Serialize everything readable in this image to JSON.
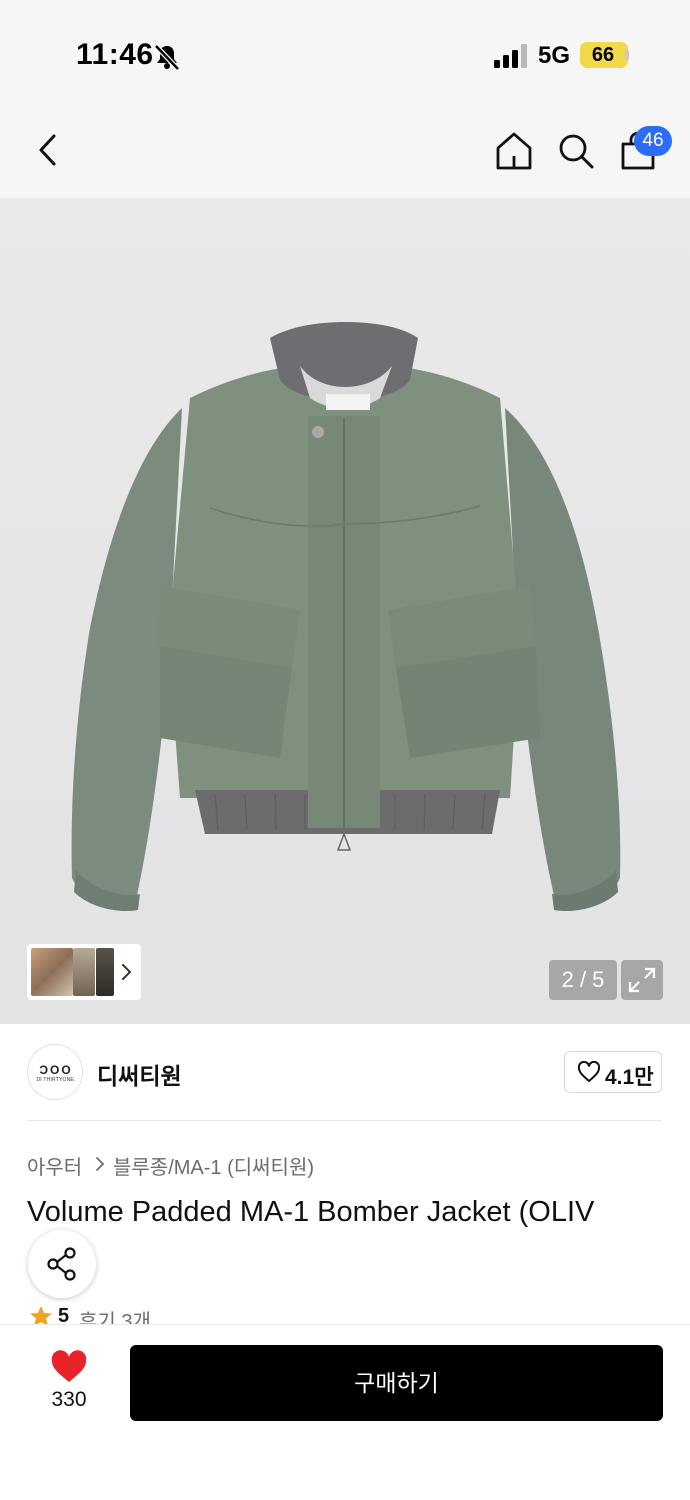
{
  "status_bar": {
    "time": "11:46",
    "network": "5G",
    "battery": "66",
    "icons": [
      "bell-off-icon",
      "signal-icon",
      "battery-icon"
    ],
    "battery_color": "#f2d94b"
  },
  "nav": {
    "icons": [
      "back-icon",
      "home-icon",
      "search-icon",
      "cart-icon"
    ],
    "cart_badge": "46",
    "badge_color": "#2d6cf6"
  },
  "gallery": {
    "counter": "2 / 5",
    "current_page": 2,
    "total_pages": 5,
    "expand_icon": "expand-icon",
    "thumbnail_chevron_icon": "chevron-right-icon"
  },
  "brand": {
    "logo_mark": "ƆOO",
    "logo_sub": "DI THIRTYONE.",
    "name": "디써티원",
    "like_count": "4.1만",
    "like_icon": "heart-outline-icon"
  },
  "breadcrumb": {
    "category": "아우터",
    "subcategory": "블루종/MA-1 (디써티원)"
  },
  "product": {
    "title": "Volume Padded MA-1 Bomber Jacket (OLIV",
    "share_icon": "share-icon",
    "rating": "5",
    "reviews": "후기 3개",
    "star_color": "#f0a321"
  },
  "bottom_bar": {
    "wish_count": "330",
    "wish_icon": "heart-filled-icon",
    "wish_color": "#e8242b",
    "buy_label": "구매하기"
  }
}
